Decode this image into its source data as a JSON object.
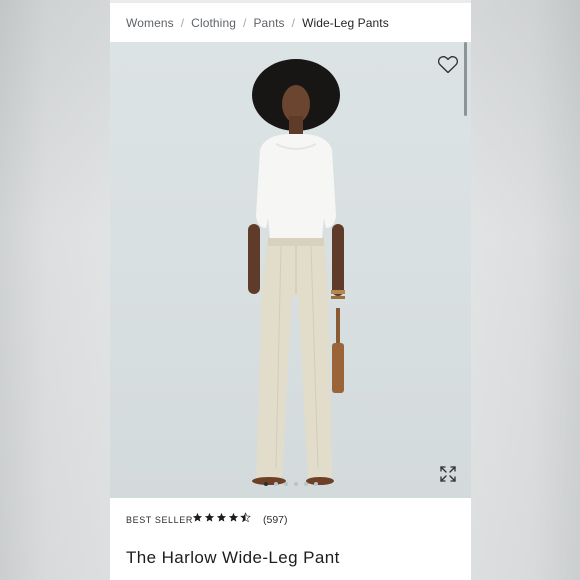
{
  "breadcrumb": {
    "items": [
      "Womens",
      "Clothing",
      "Pants"
    ],
    "separator": "/",
    "current": "Wide-Leg Pants"
  },
  "hero": {
    "favorite_icon": "heart-icon",
    "expand_icon": "expand-icon",
    "carousel_total": 6,
    "carousel_active": 1
  },
  "product": {
    "badge": "BEST SELLER",
    "rating": 4.5,
    "rating_max": 5,
    "review_count": "(597)",
    "title": "The Harlow Wide-Leg Pant"
  },
  "colors": {
    "page_background": "#e4e6e7",
    "hero_background": "#dce3e5",
    "text_primary": "#1b1e20",
    "star": "#1b1e20"
  }
}
